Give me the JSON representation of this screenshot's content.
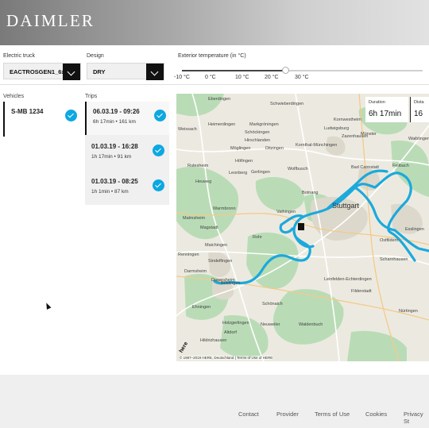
{
  "header": {
    "logo_text": "DAIMLER"
  },
  "controls": {
    "truck_label": "Electric truck",
    "truck_value": "EACTROSGEN1_6x2",
    "design_label": "Design",
    "design_value": "DRY",
    "temp_label": "Exterior temperature (in °C)",
    "temp_ticks": [
      "-10 °C",
      "0 °C",
      "10 °C",
      "20 °C",
      "30 °C"
    ],
    "temp_value_fraction": 0.43
  },
  "vehicles": {
    "heading": "Vehicles",
    "items": [
      {
        "name": "S-MB 1234"
      }
    ]
  },
  "trips": {
    "heading": "Trips",
    "items": [
      {
        "date": "06.03.19 - 09:26",
        "meta": "6h 17min • 161 km"
      },
      {
        "date": "01.03.19 - 16:28",
        "meta": "1h 17min • 91 km"
      },
      {
        "date": "01.03.19 - 08:25",
        "meta": "1h 1min • 87 km"
      }
    ]
  },
  "map": {
    "duration_label": "Duration",
    "duration_value": "6h 17min",
    "distance_label": "Dista",
    "distance_value": "16",
    "copyright": "© 1987–2019 HERE, Deutschland | Terms of Use of HERE",
    "logo": "here",
    "route_color": "#1ba9dc",
    "places": [
      "Eberdingen",
      "Schwieberdingen",
      "Kornwestheim",
      "Weissach",
      "Heimerdingen",
      "Markgröningen",
      "Schöckingen",
      "Ludwigsburg",
      "Zazenhausen",
      "Hirschlanden",
      "Ditzingen",
      "Möglingen",
      "Kornthal-Münchingen",
      "Rutesheim",
      "Höfingen",
      "Münster",
      "Waiblingen",
      "Leonberg",
      "Gerlingen",
      "Wolfbusch",
      "Bad Cannstatt",
      "Fellbach",
      "Heuweg",
      "Botnang",
      "Stuttgart",
      "Malmsheim",
      "Warmbronn",
      "Magstadt",
      "Vaihingen",
      "Rohr",
      "Ostfildern",
      "Renningen",
      "Maichingen",
      "Sindelfingen",
      "Leinfelden-Echterdingen",
      "Filderstadt",
      "Böblingen",
      "Darmsheim",
      "Dagersheim",
      "Ehningen",
      "Holzgerlingen",
      "Altdorf",
      "Hildrizhausen",
      "Waldenbuch",
      "Schönaich",
      "Neuweiler",
      "Esslingen",
      "Scharnhausen",
      "Nürtingen"
    ]
  },
  "footer": {
    "links": [
      "Contact",
      "Provider",
      "Terms of Use",
      "Cookies",
      "Privacy St"
    ]
  }
}
